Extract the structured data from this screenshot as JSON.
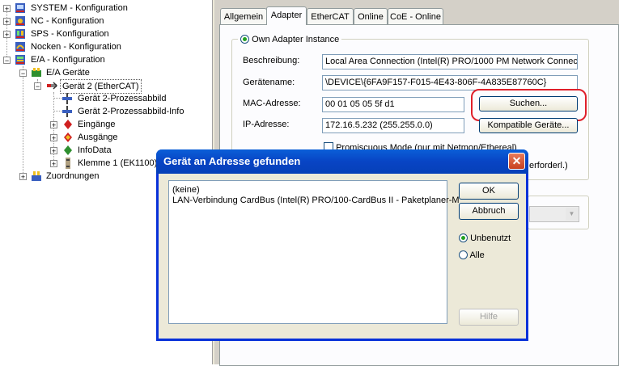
{
  "tree": {
    "items": [
      {
        "label": "SYSTEM - Konfiguration",
        "icon": "system-config-icon",
        "expander": "+"
      },
      {
        "label": "NC - Konfiguration",
        "icon": "nc-config-icon",
        "expander": "+"
      },
      {
        "label": "SPS - Konfiguration",
        "icon": "plc-config-icon",
        "expander": "+"
      },
      {
        "label": "Nocken - Konfiguration",
        "icon": "cam-config-icon",
        "expander": ""
      },
      {
        "label": "E/A - Konfiguration",
        "icon": "io-config-icon",
        "expander": "-"
      },
      {
        "label": "E/A Geräte",
        "icon": "io-devices-icon",
        "expander": "-"
      },
      {
        "label": "Gerät 2 (EtherCAT)",
        "icon": "ethercat-device-icon",
        "expander": "-"
      },
      {
        "label": "Gerät 2-Prozessabbild",
        "icon": "process-image-icon",
        "expander": ""
      },
      {
        "label": "Gerät 2-Prozessabbild-Info",
        "icon": "process-image-info-icon",
        "expander": ""
      },
      {
        "label": "Eingänge",
        "icon": "inputs-icon",
        "expander": "+"
      },
      {
        "label": "Ausgänge",
        "icon": "outputs-icon",
        "expander": "+"
      },
      {
        "label": "InfoData",
        "icon": "infodata-icon",
        "expander": "+"
      },
      {
        "label": "Klemme 1 (EK1100)",
        "icon": "terminal-icon",
        "expander": "+"
      },
      {
        "label": "Zuordnungen",
        "icon": "mappings-icon",
        "expander": "+"
      }
    ]
  },
  "tabs": [
    "Allgemein",
    "Adapter",
    "EtherCAT",
    "Online",
    "CoE - Online"
  ],
  "active_tab": "Adapter",
  "adapter": {
    "own_adapter_label": "Own Adapter Instance",
    "beschreibung_label": "Beschreibung:",
    "beschreibung_value": "Local Area Connection (Intel(R) PRO/1000 PM Network Connect",
    "geraetename_label": "Gerätename:",
    "geraetename_value": "\\DEVICE\\{6FA9F157-F015-4E43-806F-4A835E87760C}",
    "mac_label": "MAC-Adresse:",
    "mac_value": "00 01 05 05 5f d1",
    "ip_label": "IP-Adresse:",
    "ip_value": "172.16.5.232 (255.255.0.0)",
    "suchen_button": "Suchen...",
    "kompatible_button": "Kompatible Geräte...",
    "promiscuous_label": "Promiscuous Mode (nur mit Netmon/Ethereal)",
    "erforderl_label": "erforderl.)"
  },
  "dialog": {
    "title": "Gerät an Adresse gefunden",
    "list_items": [
      "(keine)",
      "LAN-Verbindung CardBus (Intel(R) PRO/100-CardBus II - Paketplaner-M"
    ],
    "ok_button": "OK",
    "abbruch_button": "Abbruch",
    "radio_unbenutzt": "Unbenutzt",
    "radio_alle": "Alle",
    "hilfe_button": "Hilfe",
    "selected_radio": "Unbenutzt"
  },
  "colors": {
    "highlight_circle": "#e0202a",
    "dialog_title_bar": "#0a5fd8",
    "close_button": "#c8401f"
  }
}
